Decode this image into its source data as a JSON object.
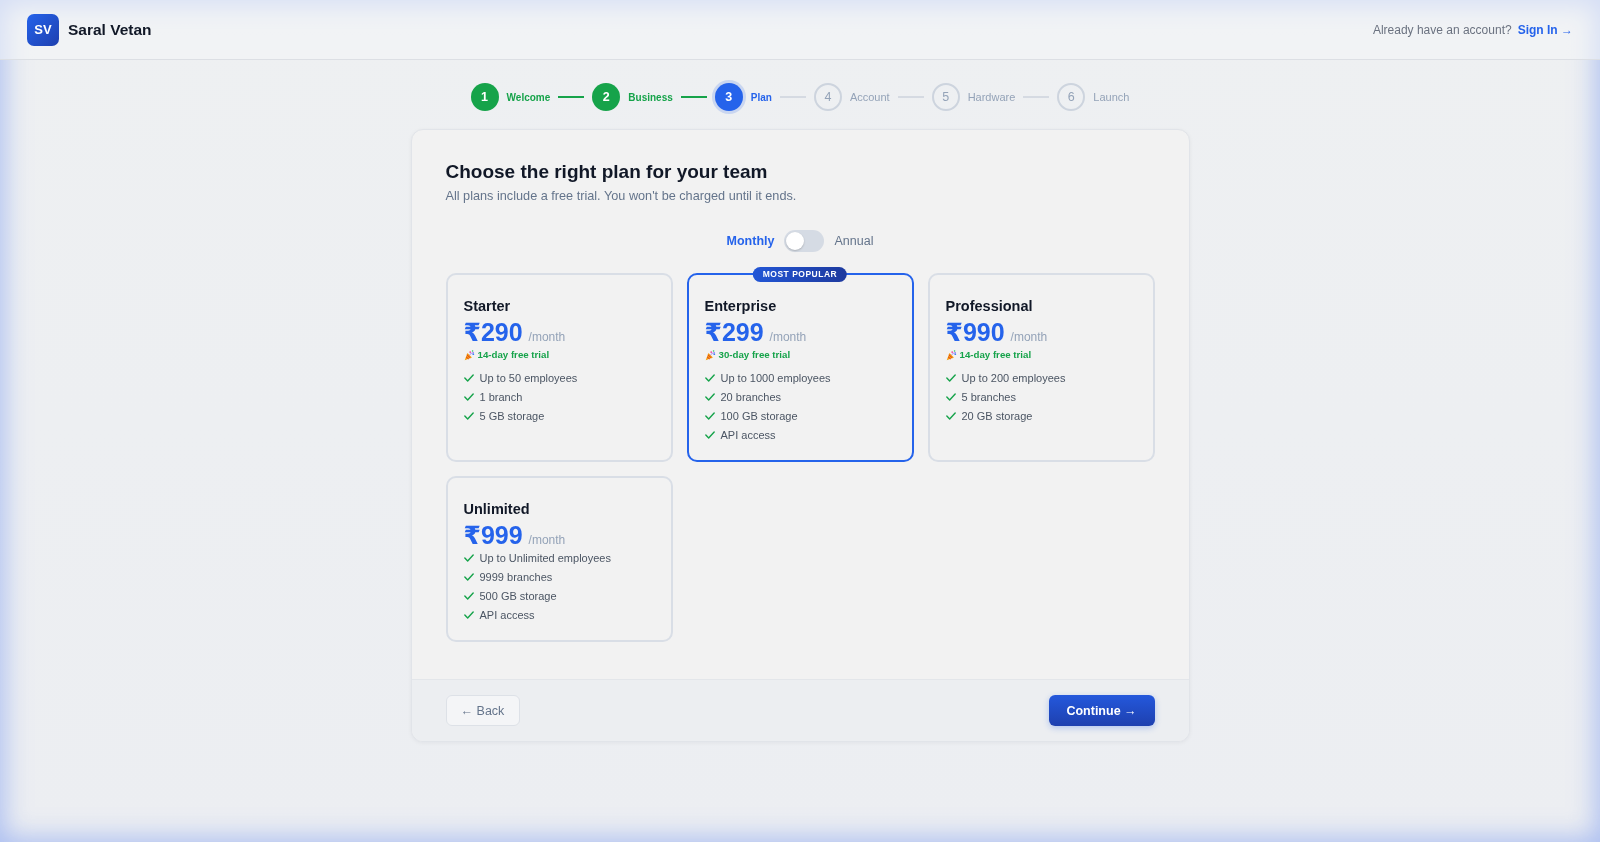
{
  "header": {
    "logo": "SV",
    "brand": "Saral Vetan",
    "prompt": "Already have an account?",
    "sign_in": "Sign In →"
  },
  "stepper": [
    {
      "number": "1",
      "label": "Welcome",
      "completed": true,
      "selected": false
    },
    {
      "number": "2",
      "label": "Business",
      "completed": true,
      "selected": false
    },
    {
      "number": "3",
      "label": "Plan",
      "completed": false,
      "selected": true
    },
    {
      "number": "4",
      "label": "Account",
      "completed": false,
      "selected": false
    },
    {
      "number": "5",
      "label": "Hardware",
      "completed": false,
      "selected": false
    },
    {
      "number": "6",
      "label": "Launch",
      "completed": false,
      "selected": false
    }
  ],
  "plan_step": {
    "title": "Choose the right plan for your team",
    "subtitle": "All plans include a free trial. You won't be charged until it ends."
  },
  "billing": {
    "left_label": "Monthly",
    "right_label": "Annual",
    "on": false
  },
  "plans": [
    {
      "name": "Starter",
      "price": "₹290",
      "period": "/month",
      "trial": "14-day free trial",
      "features": [
        "Up to 50 employees",
        "1 branch",
        "5 GB storage"
      ],
      "selected": false
    },
    {
      "name": "Enterprise",
      "price": "₹299",
      "period": "/month",
      "trial": "30-day free trial",
      "badge": "MOST POPULAR",
      "features": [
        "Up to 1000 employees",
        "20 branches",
        "100 GB storage",
        "API access"
      ],
      "selected": true
    },
    {
      "name": "Professional",
      "price": "₹990",
      "period": "/month",
      "trial": "14-day free trial",
      "features": [
        "Up to 200 employees",
        "5 branches",
        "20 GB storage"
      ],
      "selected": false
    },
    {
      "name": "Unlimited",
      "price": "₹999",
      "period": "/month",
      "features": [
        "Up to Unlimited employees",
        "9999 branches",
        "500 GB storage",
        "API access"
      ],
      "selected": false
    }
  ],
  "footer": {
    "back": "← Back",
    "continue": "Continue →"
  }
}
